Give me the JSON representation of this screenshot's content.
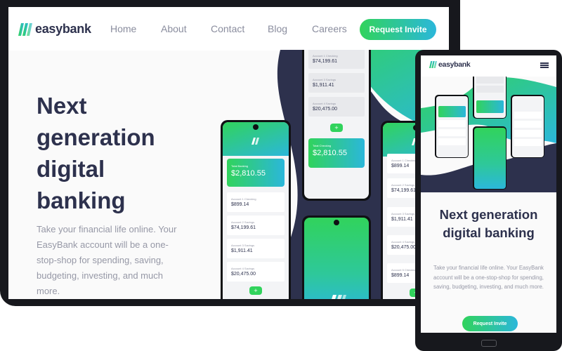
{
  "brand": {
    "name": "easybank"
  },
  "colors": {
    "navy": "#2d314d",
    "green": "#31d35c",
    "cyan": "#2bb7da",
    "gray": "#9698a6",
    "device": "#17181d"
  },
  "desktop": {
    "nav": {
      "links": [
        "Home",
        "About",
        "Contact",
        "Blog",
        "Careers"
      ],
      "cta": "Request Invite"
    },
    "hero": {
      "title": "Next generation digital banking",
      "description": "Take your financial life online. Your EasyBank account will be a one-stop-shop for spending, saving, budgeting, investing, and much more."
    }
  },
  "mobile": {
    "title": "Next generation digital banking",
    "description": "Take your financial life online. Your EasyBank account will be a one-stop-shop for spending, saving, budgeting, investing, and much more.",
    "cta": "Request Invite",
    "menu_icon": "hamburger-icon"
  },
  "app_screens": {
    "total_label": "Total Banking",
    "total_checking_label": "Total Checking",
    "total_amount": "$2,810.55",
    "accounts": [
      {
        "label": "Account 1 Checking",
        "amount": "$899.14"
      },
      {
        "label": "Account 2 Savings",
        "amount": "$74,199.61"
      },
      {
        "label": "Account 3 Savings",
        "amount": "$1,911.41"
      },
      {
        "label": "Account 4 Savings",
        "amount": "$20,475.00"
      },
      {
        "label": "Account 5 Checking",
        "amount": "$899.14"
      }
    ],
    "fab_icon": "plus-icon"
  }
}
